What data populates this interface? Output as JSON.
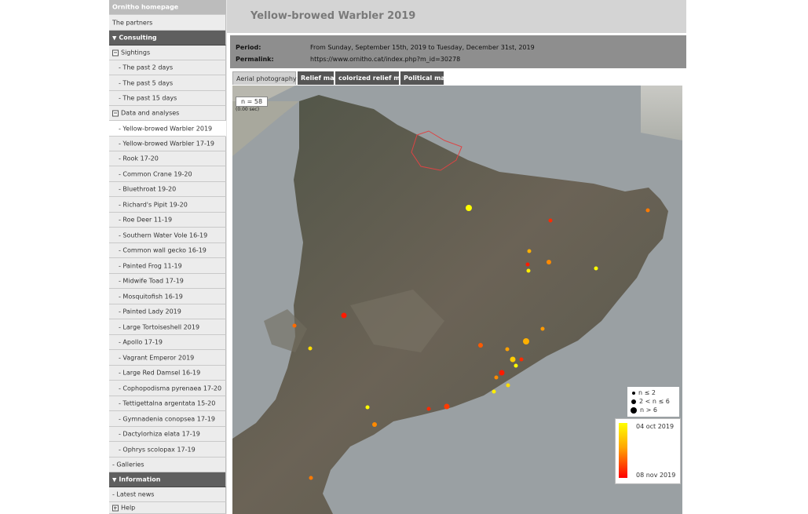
{
  "sidebar": {
    "homepage": "Ornitho homepage",
    "partners": "The partners",
    "consulting": "Consulting",
    "sightings": "Sightings",
    "past2": "- The past 2 days",
    "past5": "- The past 5 days",
    "past15": "- The past 15 days",
    "data_analyses": "Data and analyses",
    "analyses": [
      "- Yellow-browed Warbler 2019",
      "- Yellow-browed Warbler 17-19",
      "- Rook 17-20",
      "- Common Crane 19-20",
      "- Bluethroat 19-20",
      "- Richard's Pipit 19-20",
      "- Roe Deer 11-19",
      "- Southern Water Vole 16-19",
      "- Common wall gecko 16-19",
      "- Painted Frog 11-19",
      "- Midwife Toad 17-19",
      "- Mosquitofish 16-19",
      "- Painted Lady 2019",
      "- Large Tortoiseshell 2019",
      "- Apollo 17-19",
      "- Vagrant Emperor 2019",
      "- Large Red Damsel 16-19",
      "- Cophopodisma pyrenaea 17-20",
      "- Tettigettalna argentata 15-20",
      "- Gymnadenia conopsea 17-19",
      "- Dactylorhiza elata 17-19",
      "- Ophrys scolopax 17-19"
    ],
    "galleries": "- Galleries",
    "information": "Information",
    "latest_news": "- Latest news",
    "help": "Help"
  },
  "page": {
    "title": "Yellow-browed Warbler 2019",
    "period_label": "Period:",
    "period_value": "From Sunday, September 15th, 2019 to Tuesday, December 31st, 2019",
    "permalink_label": "Permalink:",
    "permalink_value": "https://www.ornitho.cat/index.php?m_id=30278"
  },
  "tabs": [
    "Aerial photography",
    "Relief map",
    "colorized relief map",
    "Political map"
  ],
  "map": {
    "count": "n = 58",
    "time": "(0.00 sec)",
    "size_legend": [
      "n ≤ 2",
      "2 < n ≤ 6",
      "n > 6"
    ],
    "color_legend_top": "04 oct 2019",
    "color_legend_bottom": "08 nov 2019",
    "colors": {
      "sea": "#9aa0a3",
      "land": "#5b5a50",
      "early": "#ffff00",
      "mid": "#ffa500",
      "late": "#ff0000"
    }
  }
}
